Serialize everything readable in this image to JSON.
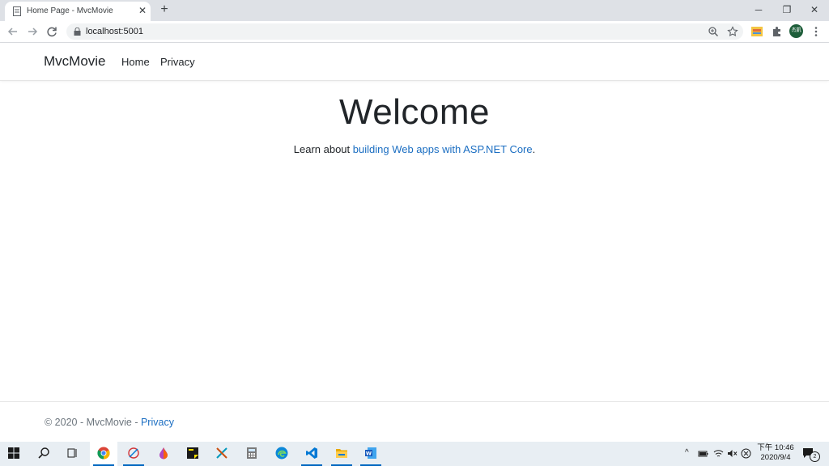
{
  "browser": {
    "tab_title": "Home Page - MvcMovie",
    "url": "localhost:5001",
    "profile_label": "杰凱"
  },
  "site": {
    "brand": "MvcMovie",
    "nav": [
      "Home",
      "Privacy"
    ],
    "heading": "Welcome",
    "learn_prefix": "Learn about ",
    "learn_link": "building Web apps with ASP.NET Core",
    "learn_suffix": ".",
    "footer_text": "© 2020 - MvcMovie - ",
    "footer_link": "Privacy"
  },
  "taskbar": {
    "time": "下午 10:46",
    "date": "2020/9/4",
    "notifications": "2"
  },
  "colors": {
    "link": "#1b6ec2",
    "taskbar_accent": "#0067c0"
  }
}
